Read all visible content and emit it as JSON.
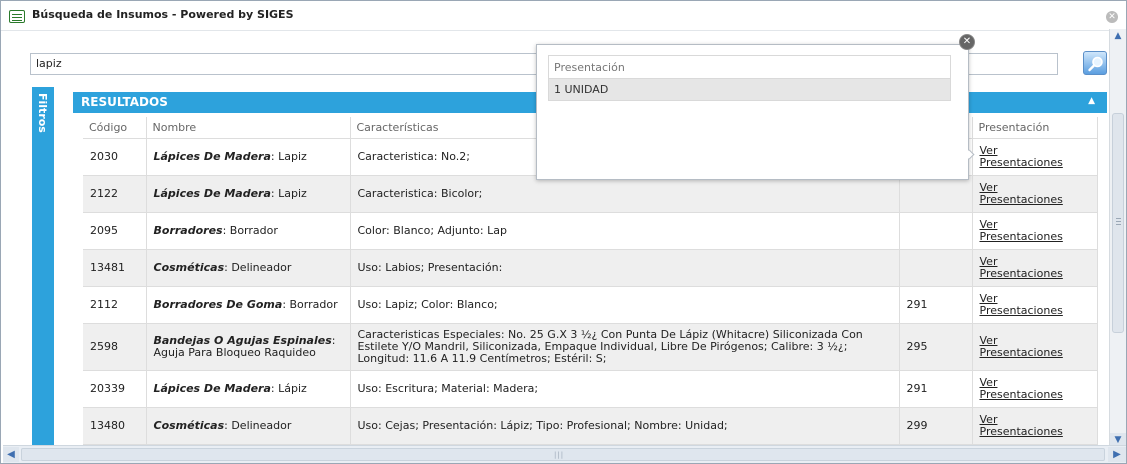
{
  "window": {
    "title": "Búsqueda de Insumos - Powered by SIGES",
    "close_glyph": "✕"
  },
  "search": {
    "value": "lapiz"
  },
  "filters_label": "Filtros",
  "results": {
    "title": "RESULTADOS",
    "columns": [
      "Código",
      "Nombre",
      "Características",
      "",
      "Presentación"
    ],
    "rows": [
      {
        "code": "2030",
        "category": "Lápices De Madera",
        "name": "Lapiz",
        "chars": "Caracteristica: No.2;",
        "num": "",
        "link1": "Ver",
        "link2": "Presentaciones"
      },
      {
        "code": "2122",
        "category": "Lápices De Madera",
        "name": "Lapiz",
        "chars": "Caracteristica: Bicolor;",
        "num": "",
        "link1": "Ver",
        "link2": "Presentaciones"
      },
      {
        "code": "2095",
        "category": "Borradores",
        "name": "Borrador",
        "chars": "Color: Blanco; Adjunto: Lap",
        "num": "",
        "link1": "Ver",
        "link2": "Presentaciones"
      },
      {
        "code": "13481",
        "category": "Cosméticas",
        "name": "Delineador",
        "chars": "Uso: Labios; Presentación:",
        "num": "",
        "link1": "Ver",
        "link2": "Presentaciones"
      },
      {
        "code": "2112",
        "category": "Borradores De Goma",
        "name": "Borrador",
        "chars": "Uso: Lapiz; Color: Blanco;",
        "num": "291",
        "link1": "Ver",
        "link2": "Presentaciones"
      },
      {
        "code": "2598",
        "category": "Bandejas O Agujas Espinales",
        "name": "Aguja Para Bloqueo Raquideo",
        "chars": "Caracteristicas Especiales: No. 25 G.X 3 ½¿ Con Punta De Lápiz (Whitacre) Siliconizada Con Estilete Y/O Mandril, Siliconizada, Empaque Individual, Libre De Pirógenos; Calibre: 3 ½¿; Longitud: 11.6 A 11.9 Centímetros; Estéril: S;",
        "num": "295",
        "link1": "Ver",
        "link2": "Presentaciones"
      },
      {
        "code": "20339",
        "category": "Lápices De Madera",
        "name": "Lápiz",
        "chars": "Uso: Escritura; Material: Madera;",
        "num": "291",
        "link1": "Ver",
        "link2": "Presentaciones"
      },
      {
        "code": "13480",
        "category": "Cosméticas",
        "name": "Delineador",
        "chars": "Uso: Cejas; Presentación: Lápiz; Tipo: Profesional; Nombre: Unidad;",
        "num": "299",
        "link1": "Ver",
        "link2": "Presentaciones"
      }
    ]
  },
  "popup": {
    "header": "Presentación",
    "rows": [
      "1 UNIDAD"
    ],
    "close_glyph": "✕"
  },
  "icons": {
    "app": "window-icon",
    "search": "magnifier-icon",
    "close": "close-icon",
    "collapse": "chevron-up-icon"
  },
  "colors": {
    "accent": "#2da2dc",
    "row_alt": "#efefef"
  }
}
